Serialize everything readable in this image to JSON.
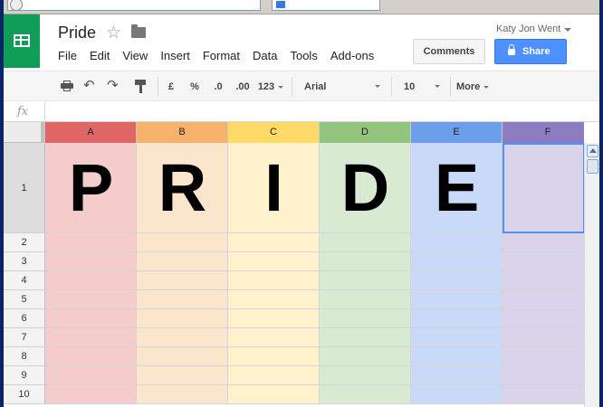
{
  "doc": {
    "title": "Pride"
  },
  "menu": [
    "File",
    "Edit",
    "View",
    "Insert",
    "Format",
    "Data",
    "Tools",
    "Add-ons"
  ],
  "account": {
    "user_name": "Katy Jon Went"
  },
  "buttons": {
    "comments": "Comments",
    "share": "Share"
  },
  "toolbar": {
    "currency": "£",
    "percent": "%",
    "decrease_decimals": ".0",
    "increase_decimals": ".00",
    "number_format": "123",
    "font": "Arial",
    "size": "10",
    "more": "More"
  },
  "formula_bar": {
    "fx": "fx"
  },
  "columns": [
    {
      "label": "A",
      "header_color": "#e06666",
      "fill": "#f4cccc"
    },
    {
      "label": "B",
      "header_color": "#f6b26b",
      "fill": "#fce5cd"
    },
    {
      "label": "C",
      "header_color": "#ffd966",
      "fill": "#fff2cc"
    },
    {
      "label": "D",
      "header_color": "#93c47d",
      "fill": "#d9ead3"
    },
    {
      "label": "E",
      "header_color": "#6d9eeb",
      "fill": "#c9daf8"
    },
    {
      "label": "F",
      "header_color": "#8e7cc3",
      "fill": "#d9d2e9"
    }
  ],
  "rows": [
    "1",
    "2",
    "3",
    "4",
    "5",
    "6",
    "7",
    "8",
    "9",
    "10"
  ],
  "row1_values": [
    "P",
    "R",
    "I",
    "D",
    "E",
    ""
  ],
  "icons": {
    "logo": "sheets-logo-icon",
    "star": "star-icon",
    "folder": "folder-icon",
    "print": "print-icon",
    "undo": "undo-icon",
    "redo": "redo-icon",
    "paint_format": "paint-format-icon",
    "lock": "lock-icon"
  }
}
